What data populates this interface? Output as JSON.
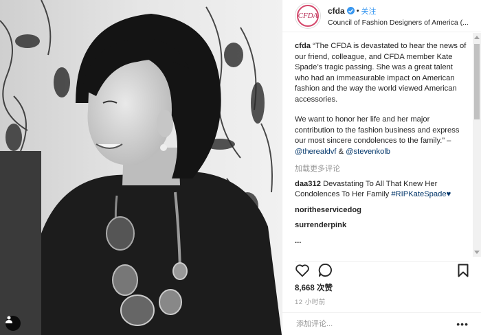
{
  "header": {
    "username": "cfda",
    "separator": "•",
    "follow_label": "关注",
    "full_name": "Council of Fashion Designers of America (...",
    "avatar_text": "CFDA"
  },
  "caption": {
    "username": "cfda",
    "paragraph1": "“The CFDA is devastated to hear the news of our friend, colleague, and CFDA member Kate Spade’s tragic passing. She was a great talent who had an immeasurable impact on American fashion and the way the world viewed American accessories.",
    "paragraph2_text": "We want to honor her life and her major contribution to the fashion business and express our most sincere condolences to the family.” – ",
    "mention1": "@therealdvf",
    "amp": " & ",
    "mention2": "@stevenkolb"
  },
  "load_more": "加载更多评论",
  "comments": [
    {
      "user": "daa312",
      "text": "Devastating To All That Knew Her  Condolences To Her Family ",
      "hashtag": "#RIPKateSpade♥"
    },
    {
      "user": "noritheservicedog",
      "text": ""
    },
    {
      "user": "surrenderpink",
      "text": ""
    },
    {
      "user": "...",
      "text": ""
    }
  ],
  "likes": "8,668 次赞",
  "timestamp": "12 小时前",
  "comment_placeholder": "添加评论...",
  "more_label": "•••",
  "colors": {
    "link": "#003569",
    "verified": "#3897f0",
    "follow": "#3897f0",
    "muted": "#999999"
  },
  "icons": {
    "like": "heart-icon",
    "comment": "comment-icon",
    "save": "bookmark-icon",
    "tag": "user-tag-icon"
  }
}
